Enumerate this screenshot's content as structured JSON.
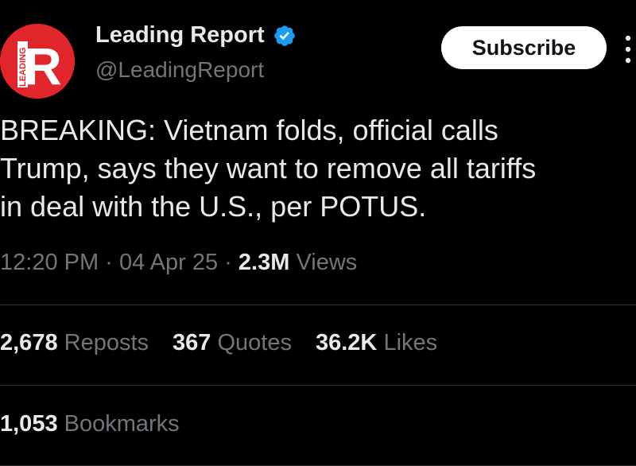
{
  "header": {
    "display_name": "Leading Report",
    "handle": "@LeadingReport",
    "subscribe_label": "Subscribe",
    "avatar_logo_text": "LEADING",
    "avatar_letter": "R"
  },
  "tweet": {
    "text": "BREAKING: Vietnam folds, official calls\nTrump, says they want to remove all tariffs\nin deal with the U.S., per POTUS.",
    "time": "12:20 PM",
    "date": "04 Apr 25",
    "views_count": "2.3M",
    "views_label": "Views",
    "separator": "·"
  },
  "stats": {
    "reposts_count": "2,678",
    "reposts_label": "Reposts",
    "quotes_count": "367",
    "quotes_label": "Quotes",
    "likes_count": "36.2K",
    "likes_label": "Likes",
    "bookmarks_count": "1,053",
    "bookmarks_label": "Bookmarks"
  },
  "icons": {
    "verified": "verified-badge-icon",
    "more": "more-vertical-icon"
  },
  "colors": {
    "background": "#000000",
    "text_primary": "#e7e9ea",
    "text_secondary": "#71767b",
    "verified_blue": "#1d9bf0",
    "avatar_red": "#e1262b",
    "divider": "#2f3336"
  }
}
